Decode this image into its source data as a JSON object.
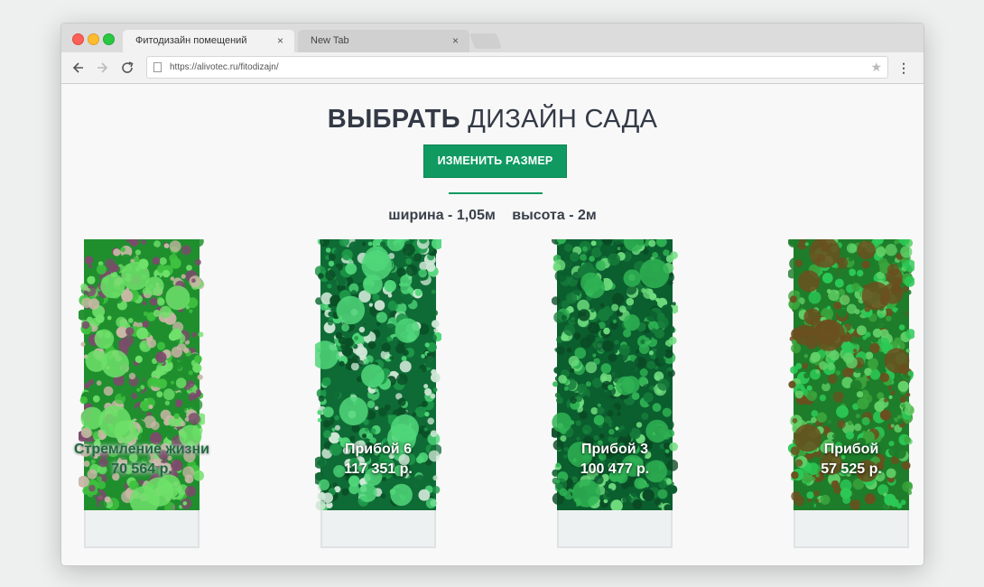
{
  "browser": {
    "tabs": [
      {
        "title": "Фитодизайн помещений",
        "active": true
      },
      {
        "title": "New Tab",
        "active": false
      }
    ],
    "url": "https://alivotec.ru/fitodizajn/",
    "tab_close": "×"
  },
  "page": {
    "title_bold": "ВЫБРАТЬ",
    "title_rest": "ДИЗАЙН САДА",
    "resize_button": "ИЗМЕНИТЬ РАЗМЕР",
    "width_text": "ширина - 1,05м",
    "height_text": "высота - 2м",
    "accent_color": "#109a62"
  },
  "gardens": [
    {
      "name": "Стремление жизни",
      "price": "70 564 р.",
      "palette": [
        "#1f8f2e",
        "#3fc23f",
        "#6fe06a",
        "#7d4a6c",
        "#c9b7a6"
      ]
    },
    {
      "name": "Прибой 6",
      "price": "117 351 р.",
      "palette": [
        "#0f6b35",
        "#1e9a4a",
        "#50d77a",
        "#cfe7d6",
        "#0a4f26"
      ]
    },
    {
      "name": "Прибой 3",
      "price": "100 477 р.",
      "palette": [
        "#0b5e2e",
        "#157b3a",
        "#2fb354",
        "#6fdd7e",
        "#0a4a25"
      ]
    },
    {
      "name": "Прибой",
      "price": "57 525 р.",
      "palette": [
        "#1e7d2a",
        "#3aa53c",
        "#6b4f1f",
        "#62d168",
        "#2cc956"
      ]
    }
  ]
}
